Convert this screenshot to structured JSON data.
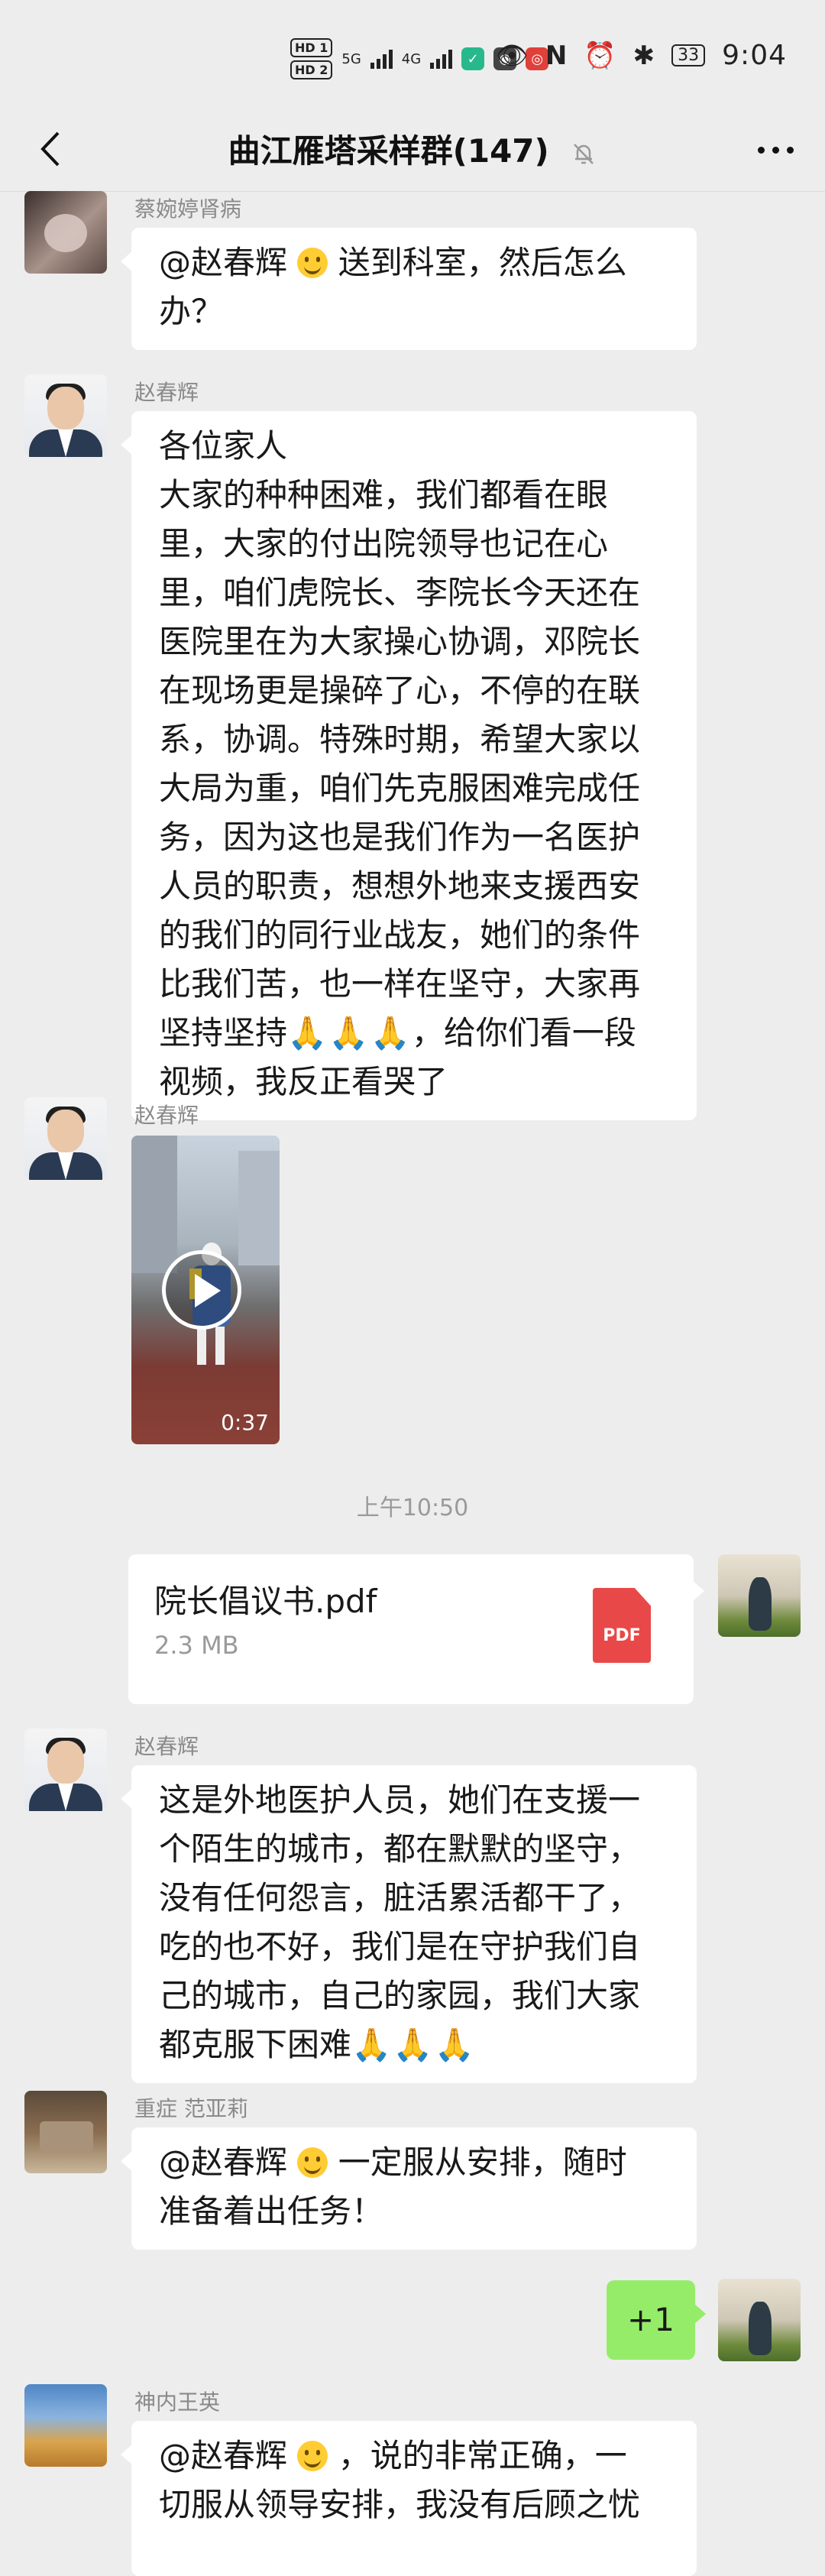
{
  "status_bar": {
    "network": [
      "HD 1",
      "HD 2",
      "5G",
      "4G"
    ],
    "battery": "33",
    "time": "9:04"
  },
  "header": {
    "title": "曲江雁塔采样群(147)"
  },
  "messages": [
    {
      "sender": "蔡婉婷肾病",
      "mention": "@赵春辉",
      "text_after_mention": " 送到科室，然后怎么\n办？"
    },
    {
      "sender": "赵春辉",
      "text": "各位家人\n大家的种种困难，我们都看在眼\n里，大家的付出院领导也记在心\n里，咱们虎院长、李院长今天还在\n医院里在为大家操心协调，邓院长\n在现场更是操碎了心，不停的在联\n系，协调。特殊时期，希望大家以\n大局为重，咱们先克服困难完成任\n务，因为这也是我们作为一名医护\n人员的职责，想想外地来支援西安\n的我们的同行业战友，她们的条件\n比我们苦，也一样在坚守，大家再\n坚持坚持",
      "pray": "🙏🙏🙏",
      "text_tail": "，给你们看一段\n视频，我反正看哭了"
    },
    {
      "sender": "赵春辉",
      "video_duration": "0:37"
    },
    {
      "timestamp": "上午10:50"
    },
    {
      "file_name": "院长倡议书.pdf",
      "file_size": "2.3 MB",
      "file_type": "PDF"
    },
    {
      "sender": "赵春辉",
      "text": "这是外地医护人员，她们在支援一\n个陌生的城市，都在默默的坚守，\n没有任何怨言，脏活累活都干了，\n吃的也不好，我们是在守护我们自\n己的城市，自己的家园，我们大家\n都克服下困难",
      "pray": "🙏🙏🙏"
    },
    {
      "sender": "重症 范亚莉",
      "mention": "@赵春辉",
      "text_after_mention": " 一定服从安排，随时\n准备着出任务！"
    },
    {
      "text": "+1"
    },
    {
      "sender": "神内王英",
      "mention": "@赵春辉",
      "text_after_mention": " ，说的非常正确，一\n切服从领导安排，我没有后顾之忧"
    }
  ]
}
